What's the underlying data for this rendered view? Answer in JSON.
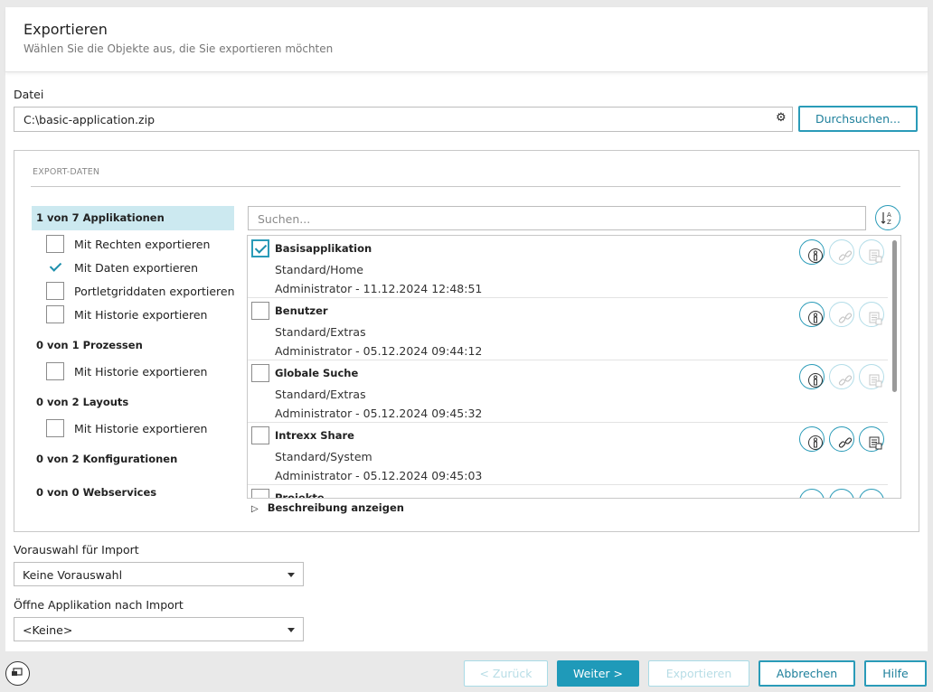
{
  "header": {
    "title": "Exportieren",
    "subtitle": "Wählen Sie die Objekte aus, die Sie exportieren möchten"
  },
  "file": {
    "label": "Datei",
    "value": "C:\\basic-application.zip",
    "browse_label": "Durchsuchen..."
  },
  "export_data": {
    "legend": "EXPORT-DATEN",
    "groups": [
      {
        "label": "1 von 7 Applikationen",
        "selected": true
      },
      {
        "label": "0 von 1 Prozessen",
        "selected": false
      },
      {
        "label": "0 von 2 Layouts",
        "selected": false
      },
      {
        "label": "0 von 2 Konfigurationen",
        "selected": false
      },
      {
        "label": "0 von 0 Webservices",
        "selected": false
      }
    ],
    "options": [
      {
        "label": "Mit Rechten exportieren",
        "checked": false
      },
      {
        "label": "Mit Daten exportieren",
        "checked": true
      },
      {
        "label": "Portletgriddaten exportieren",
        "checked": false
      },
      {
        "label": "Mit Historie exportieren",
        "checked": false
      },
      {
        "label": "Mit Historie exportieren",
        "checked": false
      },
      {
        "label": "Mit Historie exportieren",
        "checked": false
      }
    ],
    "search_placeholder": "Suchen...",
    "sort_icon": "sort-az-icon",
    "items": [
      {
        "name": "Basisapplikation",
        "path": "Standard/Home",
        "meta": "Administrator - 11.12.2024 12:48:51",
        "checked": true,
        "rights_active": true,
        "link_active": false,
        "data_active": false
      },
      {
        "name": "Benutzer",
        "path": "Standard/Extras",
        "meta": "Administrator - 05.12.2024 09:44:12",
        "checked": false,
        "rights_active": true,
        "link_active": false,
        "data_active": false
      },
      {
        "name": "Globale Suche",
        "path": "Standard/Extras",
        "meta": "Administrator - 05.12.2024 09:45:32",
        "checked": false,
        "rights_active": true,
        "link_active": false,
        "data_active": false
      },
      {
        "name": "Intrexx Share",
        "path": "Standard/System",
        "meta": "Administrator - 05.12.2024 09:45:03",
        "checked": false,
        "rights_active": true,
        "link_active": true,
        "data_active": true
      },
      {
        "name": "Projekte",
        "path": "",
        "meta": "",
        "checked": false,
        "rights_active": true,
        "link_active": true,
        "data_active": true
      }
    ],
    "description_toggle": "Beschreibung anzeigen"
  },
  "preselect": {
    "label": "Vorauswahl für Import",
    "value": "Keine Vorauswahl"
  },
  "open_app": {
    "label": "Öffne Applikation nach Import",
    "value": "<Keine>"
  },
  "footer": {
    "back": "< Zurück",
    "next": "Weiter >",
    "export": "Exportieren",
    "cancel": "Abbrechen",
    "help": "Hilfe"
  },
  "colors": {
    "accent": "#1f9ab9",
    "selection": "#cce9f0"
  }
}
